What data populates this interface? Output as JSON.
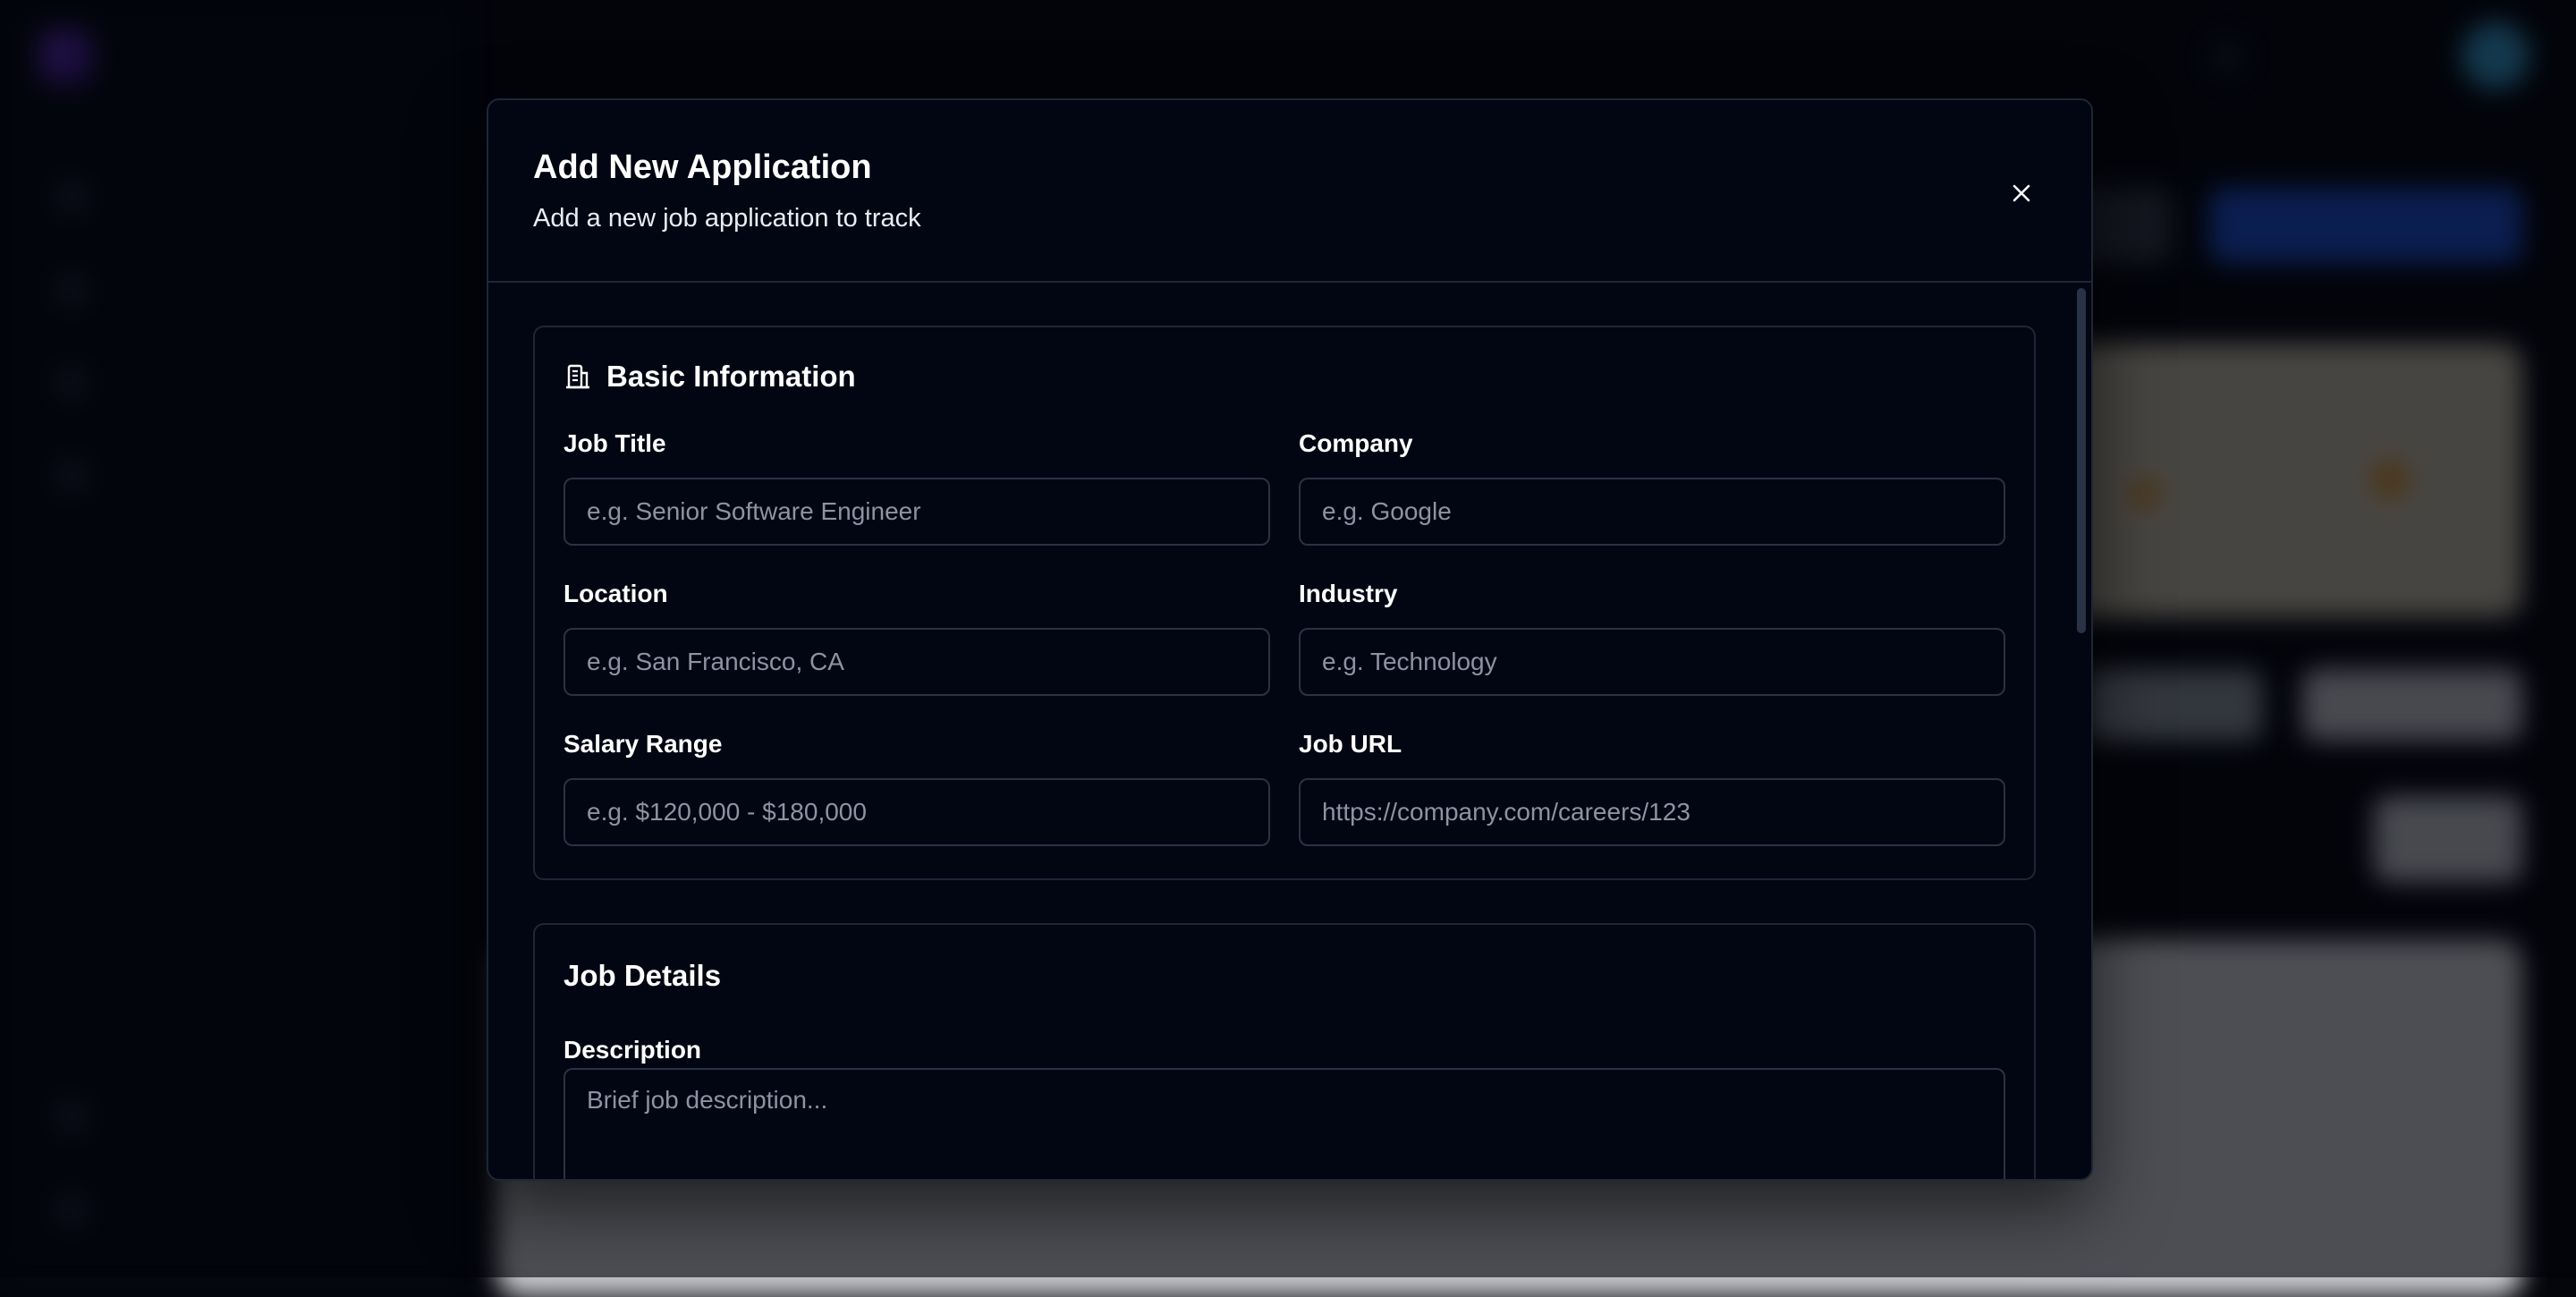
{
  "modal": {
    "title": "Add New Application",
    "subtitle": "Add a new job application to track",
    "close_icon": "close-icon"
  },
  "basic_info": {
    "title": "Basic Information",
    "icon": "building-icon",
    "fields": {
      "job_title": {
        "label": "Job Title",
        "placeholder": "e.g. Senior Software Engineer",
        "value": ""
      },
      "company": {
        "label": "Company",
        "placeholder": "e.g. Google",
        "value": ""
      },
      "location": {
        "label": "Location",
        "placeholder": "e.g. San Francisco, CA",
        "value": ""
      },
      "industry": {
        "label": "Industry",
        "placeholder": "e.g. Technology",
        "value": ""
      },
      "salary_range": {
        "label": "Salary Range",
        "placeholder": "e.g. $120,000 - $180,000",
        "value": ""
      },
      "job_url": {
        "label": "Job URL",
        "placeholder": "https://company.com/careers/123",
        "value": ""
      }
    }
  },
  "job_details": {
    "title": "Job Details",
    "fields": {
      "description": {
        "label": "Description",
        "placeholder": "Brief job description...",
        "value": ""
      }
    }
  },
  "colors": {
    "background": "#04060c",
    "modal_bg": "#020612",
    "border": "#1e2637",
    "input_border": "#2a3244",
    "placeholder": "#8c93a3",
    "accent_blue": "#1f56e0",
    "brand_purple": "#6d35d6"
  }
}
